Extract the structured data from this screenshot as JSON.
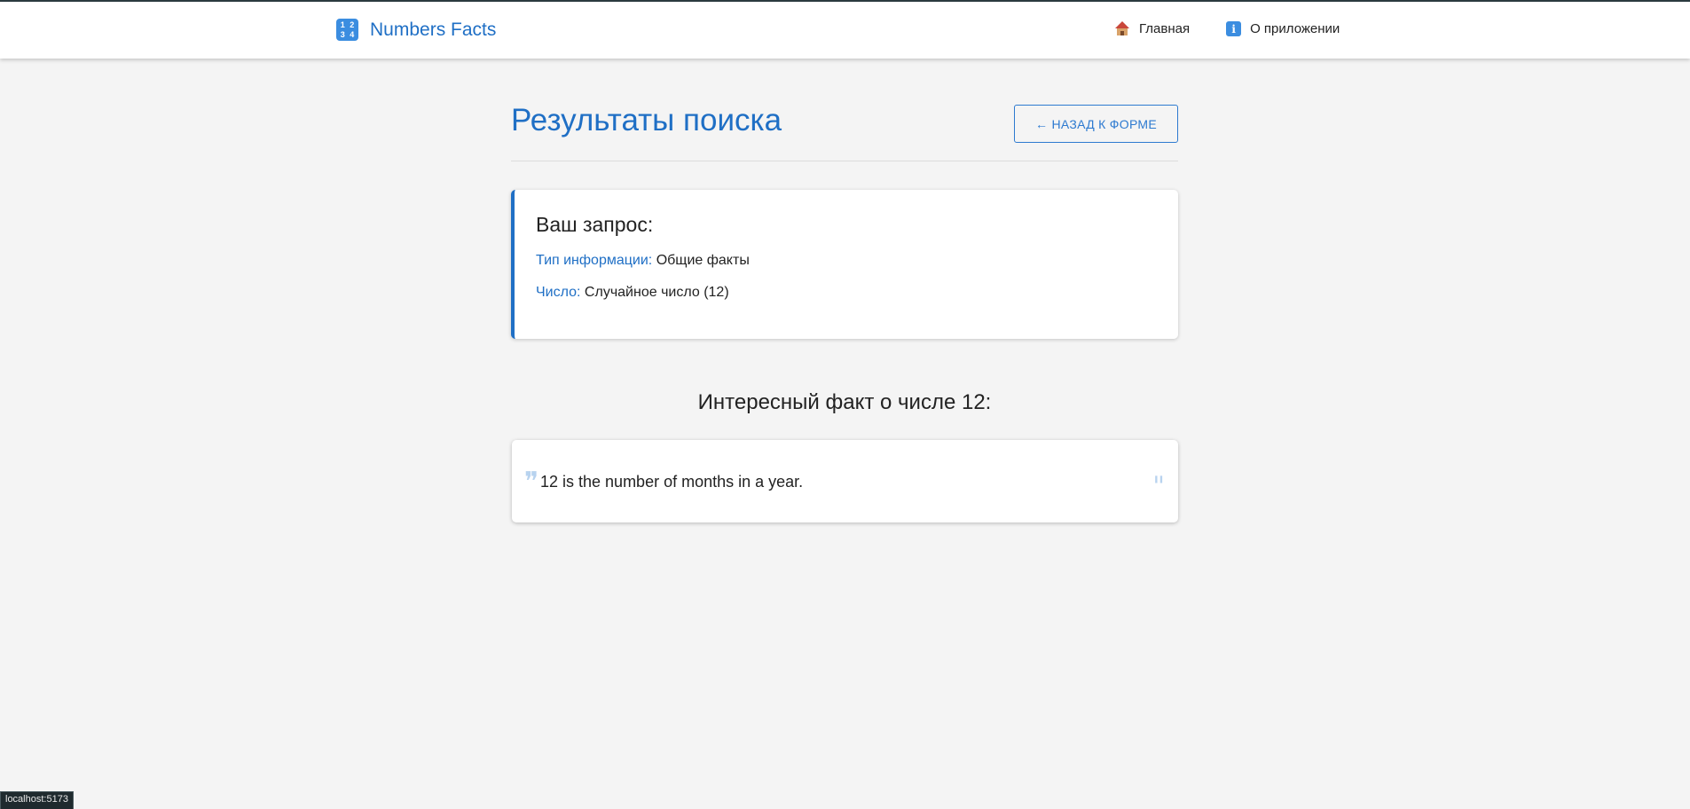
{
  "navbar": {
    "brand_label": "Numbers Facts",
    "brand_icon": "numbers-1234-icon",
    "links": [
      {
        "label": "Главная",
        "icon": "home-icon"
      },
      {
        "label": "О приложении",
        "icon": "info-icon"
      }
    ]
  },
  "page": {
    "title": "Результаты поиска",
    "back_button_label": "← НАЗАД К ФОРМЕ"
  },
  "query": {
    "title": "Ваш запрос:",
    "type_label": "Тип информации:",
    "type_value": "Общие факты",
    "number_label": "Число:",
    "number_value": "Случайное число (12)"
  },
  "fact": {
    "heading": "Интересный факт о числе 12:",
    "text": "12 is the number of months in a year."
  },
  "status_bar": {
    "url": "localhost:5173"
  },
  "colors": {
    "accent": "#1f6fc5",
    "background": "#f4f4f4",
    "card": "#ffffff",
    "quote_mark": "#b8d3ef"
  }
}
